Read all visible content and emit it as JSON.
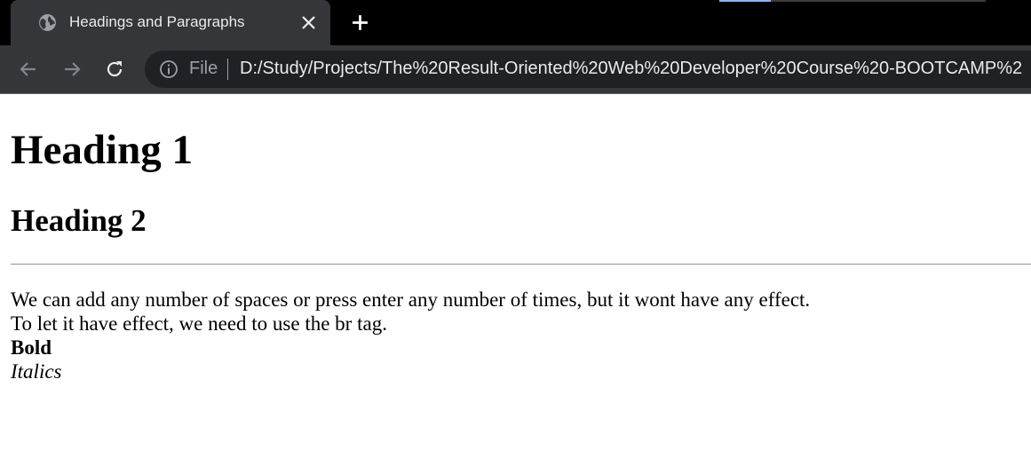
{
  "browser": {
    "tab": {
      "title": "Headings and Paragraphs",
      "favicon": "globe-icon",
      "close_icon": "close-icon"
    },
    "new_tab_icon": "plus-icon",
    "toolbar": {
      "back_icon": "arrow-left-icon",
      "forward_icon": "arrow-right-icon",
      "reload_icon": "reload-icon"
    },
    "omnibox": {
      "info_icon": "info-icon",
      "scheme": "File",
      "url": "D:/Study/Projects/The%20Result-Oriented%20Web%20Developer%20Course%20-BOOTCAMP%2"
    },
    "colors": {
      "tabstrip_bg": "#000000",
      "active_tab_bg": "#35363a",
      "omnibox_bg": "#202124",
      "chrome_text": "#e8eaed",
      "muted_text": "#9aa0a6"
    }
  },
  "page": {
    "heading1": "Heading 1",
    "heading2": "Heading 2",
    "paragraph": {
      "line1": "We can add any number of spaces or press enter any number of times, but it wont have any effect.",
      "line2": "To let it have effect, we need to use the br tag.",
      "bold": "Bold",
      "italics": "Italics"
    }
  }
}
